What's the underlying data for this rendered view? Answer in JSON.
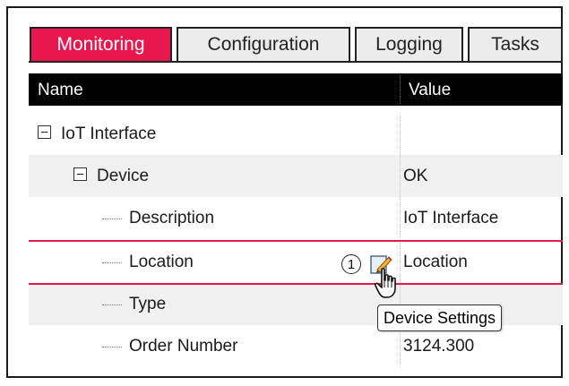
{
  "tabs": [
    {
      "label": "Monitoring",
      "active": true
    },
    {
      "label": "Configuration",
      "active": false
    },
    {
      "label": "Logging",
      "active": false
    },
    {
      "label": "Tasks",
      "active": false
    }
  ],
  "columns": {
    "name": "Name",
    "value": "Value"
  },
  "rows": [
    {
      "name": "IoT Interface",
      "value": ""
    },
    {
      "name": "Device",
      "value": "OK"
    },
    {
      "name": "Description",
      "value": "IoT Interface"
    },
    {
      "name": "Location",
      "value": "Location"
    },
    {
      "name": "Type",
      "value": ""
    },
    {
      "name": "Order Number",
      "value": "3124.300"
    }
  ],
  "callout": {
    "number": "1"
  },
  "tooltip": {
    "text": "Device Settings"
  },
  "colors": {
    "accent": "#e8174d",
    "header_bg": "#000000"
  },
  "icons": {
    "edit": "edit-pencil-icon",
    "cursor": "hand-pointer-icon",
    "expander": "collapse-minus-icon"
  }
}
